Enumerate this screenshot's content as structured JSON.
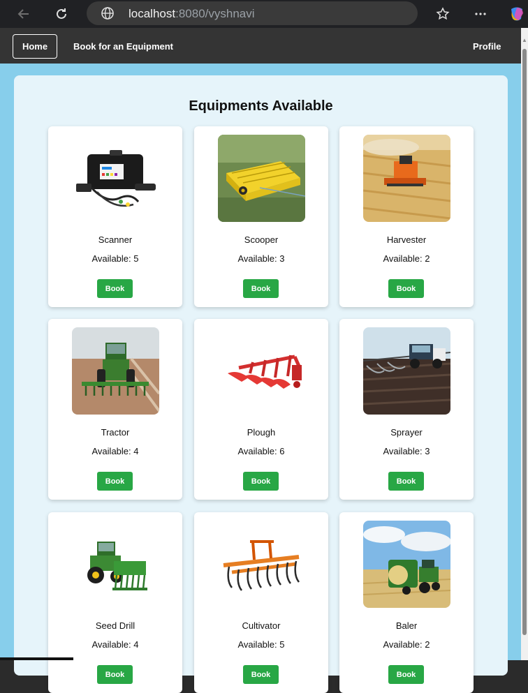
{
  "browser": {
    "url_host": "localhost",
    "url_path": ":8080/vyshnavi"
  },
  "navbar": {
    "home_label": "Home",
    "book_label": "Book for an Equipment",
    "profile_label": "Profile"
  },
  "main": {
    "title": "Equipments Available",
    "book_label": "Book",
    "cards": [
      {
        "name": "Scanner",
        "available": "Available: 5"
      },
      {
        "name": "Scooper",
        "available": "Available: 3"
      },
      {
        "name": "Harvester",
        "available": "Available: 2"
      },
      {
        "name": "Tractor",
        "available": "Available: 4"
      },
      {
        "name": "Plough",
        "available": "Available: 6"
      },
      {
        "name": "Sprayer",
        "available": "Available: 3"
      },
      {
        "name": "Seed Drill",
        "available": "Available: 4"
      },
      {
        "name": "Cultivator",
        "available": "Available: 5"
      },
      {
        "name": "Baler",
        "available": "Available: 2"
      }
    ]
  },
  "colors": {
    "page_bg": "#87ceeb",
    "container_bg": "#e6f4fa",
    "navbar_bg": "#343434",
    "book_button": "#28a745"
  }
}
